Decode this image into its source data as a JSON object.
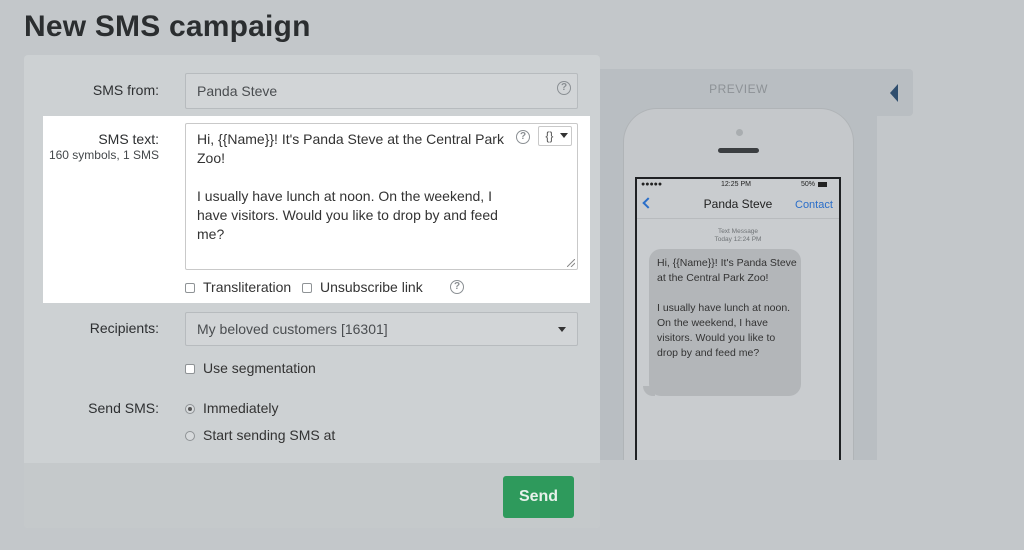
{
  "page": {
    "title": "New SMS campaign"
  },
  "form": {
    "sms_from": {
      "label": "SMS from:",
      "value": "Panda Steve"
    },
    "sms_text": {
      "label": "SMS text:",
      "counter": "160 symbols, 1 SMS",
      "value": "Hi, {{Name}}! It's Panda Steve at the Central Park Zoo!\n\nI usually have lunch at noon. On the weekend, I have visitors. Would you like to drop by and feed me?",
      "variable_button": "{}"
    },
    "options": {
      "transliteration": {
        "label": "Transliteration",
        "checked": false
      },
      "unsubscribe": {
        "label": "Unsubscribe link",
        "checked": false
      }
    },
    "recipients": {
      "label": "Recipients:",
      "value": "My beloved customers [16301]"
    },
    "segmentation": {
      "label": "Use segmentation",
      "checked": false
    },
    "send_sms": {
      "label": "Send SMS:",
      "options": [
        {
          "label": "Immediately",
          "selected": true
        },
        {
          "label": "Start sending SMS at",
          "selected": false
        }
      ]
    },
    "send_button": "Send"
  },
  "preview": {
    "title": "PREVIEW",
    "status": {
      "carrier": "●●●●● ",
      "time": "12:25 PM",
      "battery": "50%"
    },
    "contact_name": "Panda Steve",
    "contact_link": "Contact",
    "meta_line1": "Text Message",
    "meta_line2": "Today 12:24 PM",
    "message": "Hi, {{Name}}! It's Panda Steve at the Central Park Zoo!\n\nI usually have lunch at noon. On the weekend, I have visitors. Would you like to drop by and feed me?"
  },
  "icons": {
    "help": "question-circle",
    "dropdown": "caret-down",
    "collapse": "triangle-left"
  }
}
